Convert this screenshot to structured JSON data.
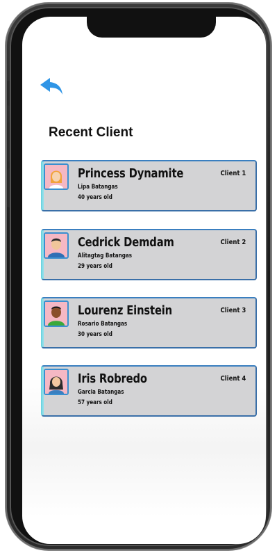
{
  "header": {
    "back_icon": "reply-arrow-icon",
    "back_color": "#2f95e6",
    "title": "Recent Client"
  },
  "clients": [
    {
      "name": "Princess Dynamite",
      "tag": "Client 1",
      "place": "Lipa Batangas",
      "age": "40 years old",
      "avatar": "female-blonde-avatar-icon"
    },
    {
      "name": "Cedrick Demdam",
      "tag": "Client 2",
      "place": "Alitagtag Batangas",
      "age": "29 years old",
      "avatar": "male-avatar-icon"
    },
    {
      "name": "Lourenz Einstein",
      "tag": "Client 3",
      "place": "Rosario Batangas",
      "age": "30 years old",
      "avatar": "male-dark-avatar-icon"
    },
    {
      "name": "Iris Robredo",
      "tag": "Client 4",
      "place": "Garcia Batangas",
      "age": "57 years old",
      "avatar": "female-dark-hair-avatar-icon"
    }
  ],
  "colors": {
    "card_bg": "#d3d3d5",
    "card_border": "#3a6fa8",
    "accent_cyan": "#6fd3e0"
  }
}
